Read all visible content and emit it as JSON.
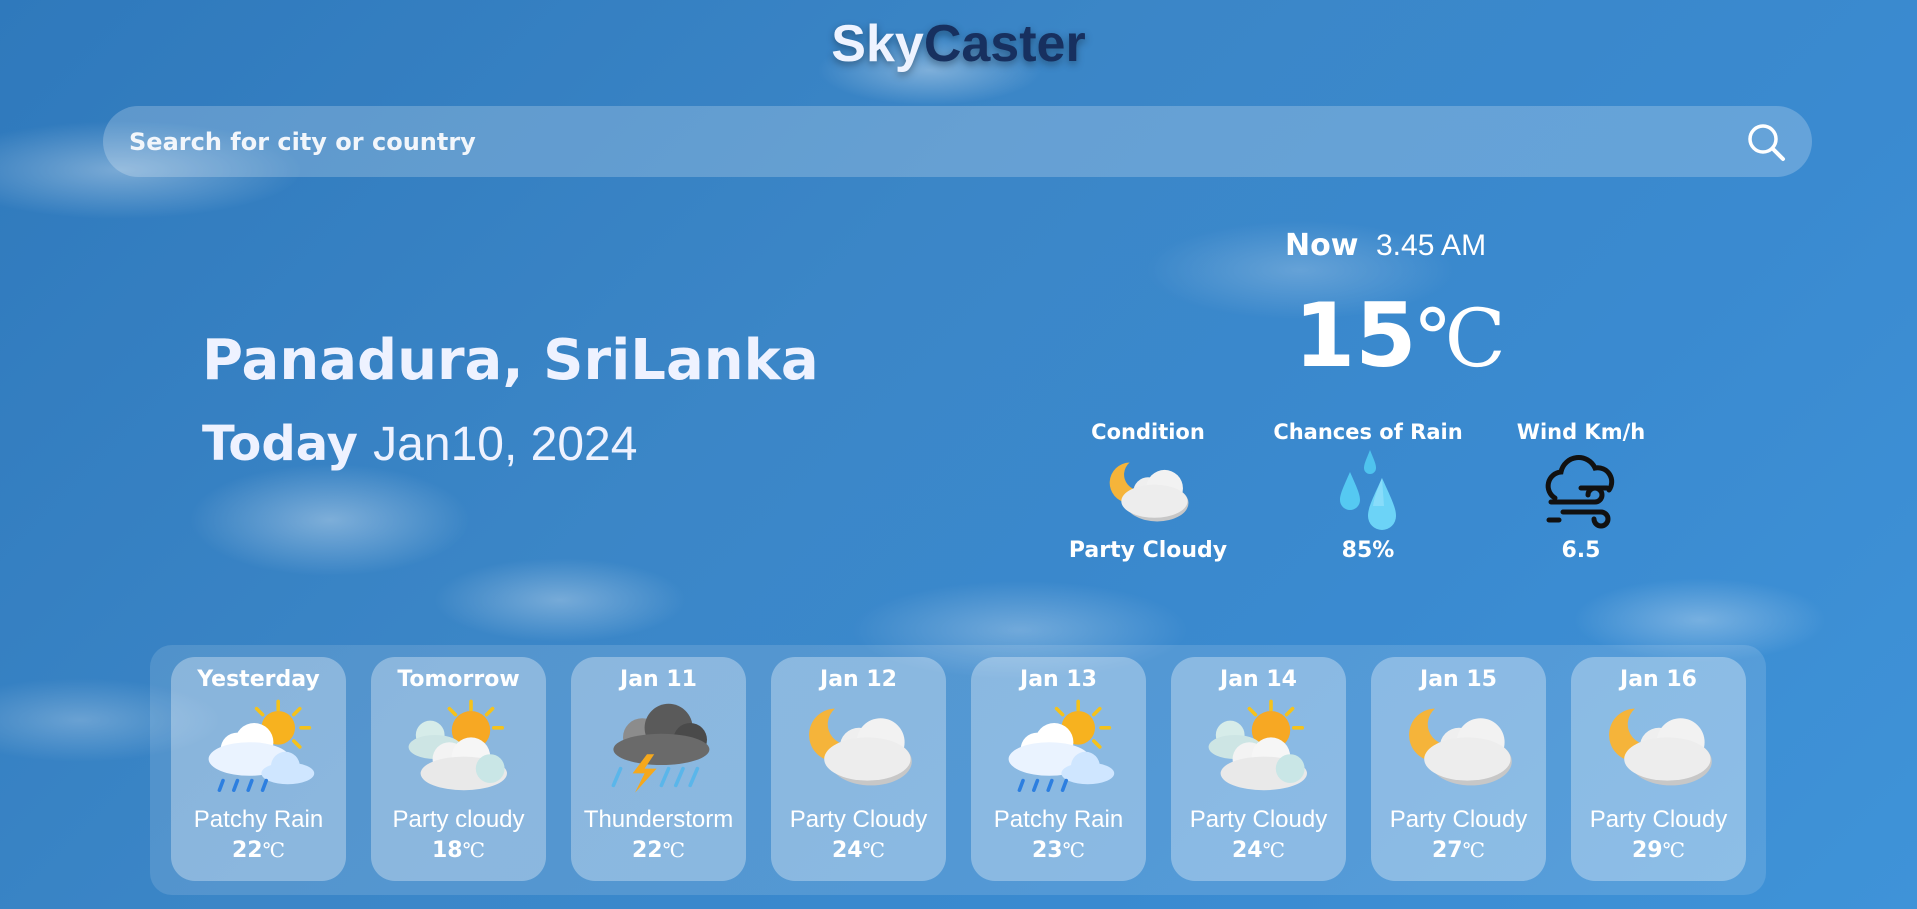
{
  "logo": {
    "part1": "Sky",
    "part2": "Caster"
  },
  "search": {
    "placeholder": "Search for city or country"
  },
  "location": {
    "city": "Panadura, SriLanka",
    "today_label": "Today",
    "date": "Jan10, 2024"
  },
  "current": {
    "now_label": "Now",
    "time": "3.45 AM",
    "temp": "15",
    "unit": "℃",
    "condition_title": "Condition",
    "condition": "Party Cloudy",
    "rain_title": "Chances of Rain",
    "rain": "85%",
    "wind_title": "Wind Km/h",
    "wind": "6.5"
  },
  "forecast": [
    {
      "day": "Yesterday",
      "icon": "sun-cloud-rain-icon",
      "condition": "Patchy Rain",
      "temp": "22",
      "unit": "℃"
    },
    {
      "day": "Tomorrow",
      "icon": "sun-clouds-icon",
      "condition": "Party cloudy",
      "temp": "18",
      "unit": "℃"
    },
    {
      "day": "Jan 11",
      "icon": "thunderstorm-icon",
      "condition": "Thunderstorm",
      "temp": "22",
      "unit": "℃"
    },
    {
      "day": "Jan 12",
      "icon": "moon-cloud-icon",
      "condition": "Party Cloudy",
      "temp": "24",
      "unit": "℃"
    },
    {
      "day": "Jan 13",
      "icon": "sun-cloud-rain-icon",
      "condition": "Patchy Rain",
      "temp": "23",
      "unit": "℃"
    },
    {
      "day": "Jan 14",
      "icon": "sun-clouds-icon",
      "condition": "Party Cloudy",
      "temp": "24",
      "unit": "℃"
    },
    {
      "day": "Jan 15",
      "icon": "moon-cloud-icon",
      "condition": "Party Cloudy",
      "temp": "27",
      "unit": "℃"
    },
    {
      "day": "Jan 16",
      "icon": "moon-cloud-icon",
      "condition": "Party Cloudy",
      "temp": "29",
      "unit": "℃"
    }
  ]
}
